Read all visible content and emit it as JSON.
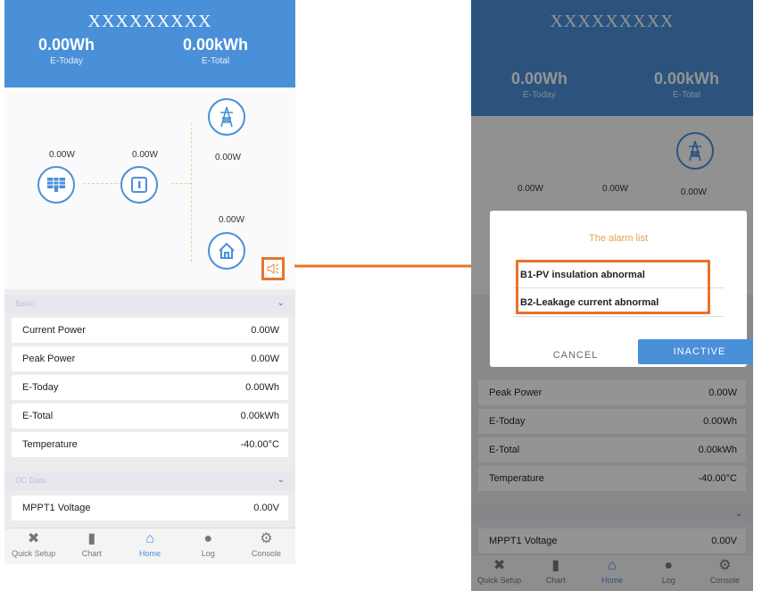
{
  "app_title": "XXXXXXXXX",
  "summary": {
    "e_today_value": "0.00Wh",
    "e_today_label": "E-Today",
    "e_total_value": "0.00kWh",
    "e_total_label": "E-Total"
  },
  "flow": {
    "pv_power": "0.00W",
    "inverter_power": "0.00W",
    "grid_power": "0.00W",
    "home_power": "0.00W"
  },
  "basic_section_label": "Basic",
  "dc_section_label": "DC Data",
  "rows": [
    {
      "label": "Current Power",
      "value": "0.00W"
    },
    {
      "label": "Peak Power",
      "value": "0.00W"
    },
    {
      "label": "E-Today",
      "value": "0.00Wh"
    },
    {
      "label": "E-Total",
      "value": "0.00kWh"
    },
    {
      "label": "Temperature",
      "value": "-40.00°C"
    }
  ],
  "mppt_row": {
    "label": "MPPT1 Voltage",
    "value": "0.00V"
  },
  "tabs": [
    {
      "label": "Quick Setup",
      "icon": "tools-icon"
    },
    {
      "label": "Chart",
      "icon": "chart-icon"
    },
    {
      "label": "Home",
      "icon": "home-icon",
      "active": true
    },
    {
      "label": "Log",
      "icon": "info-icon"
    },
    {
      "label": "Console",
      "icon": "gear-icon"
    }
  ],
  "alarm_dialog": {
    "title": "The alarm list",
    "items": [
      "B1-PV insulation abnormal",
      "B2-Leakage current abnormal"
    ],
    "cancel_label": "CANCEL",
    "inactive_label": "INACTIVE"
  },
  "colors": {
    "brand_blue": "#4a90d9",
    "highlight_orange": "#e8732a",
    "dialog_title": "#e8a04a"
  }
}
